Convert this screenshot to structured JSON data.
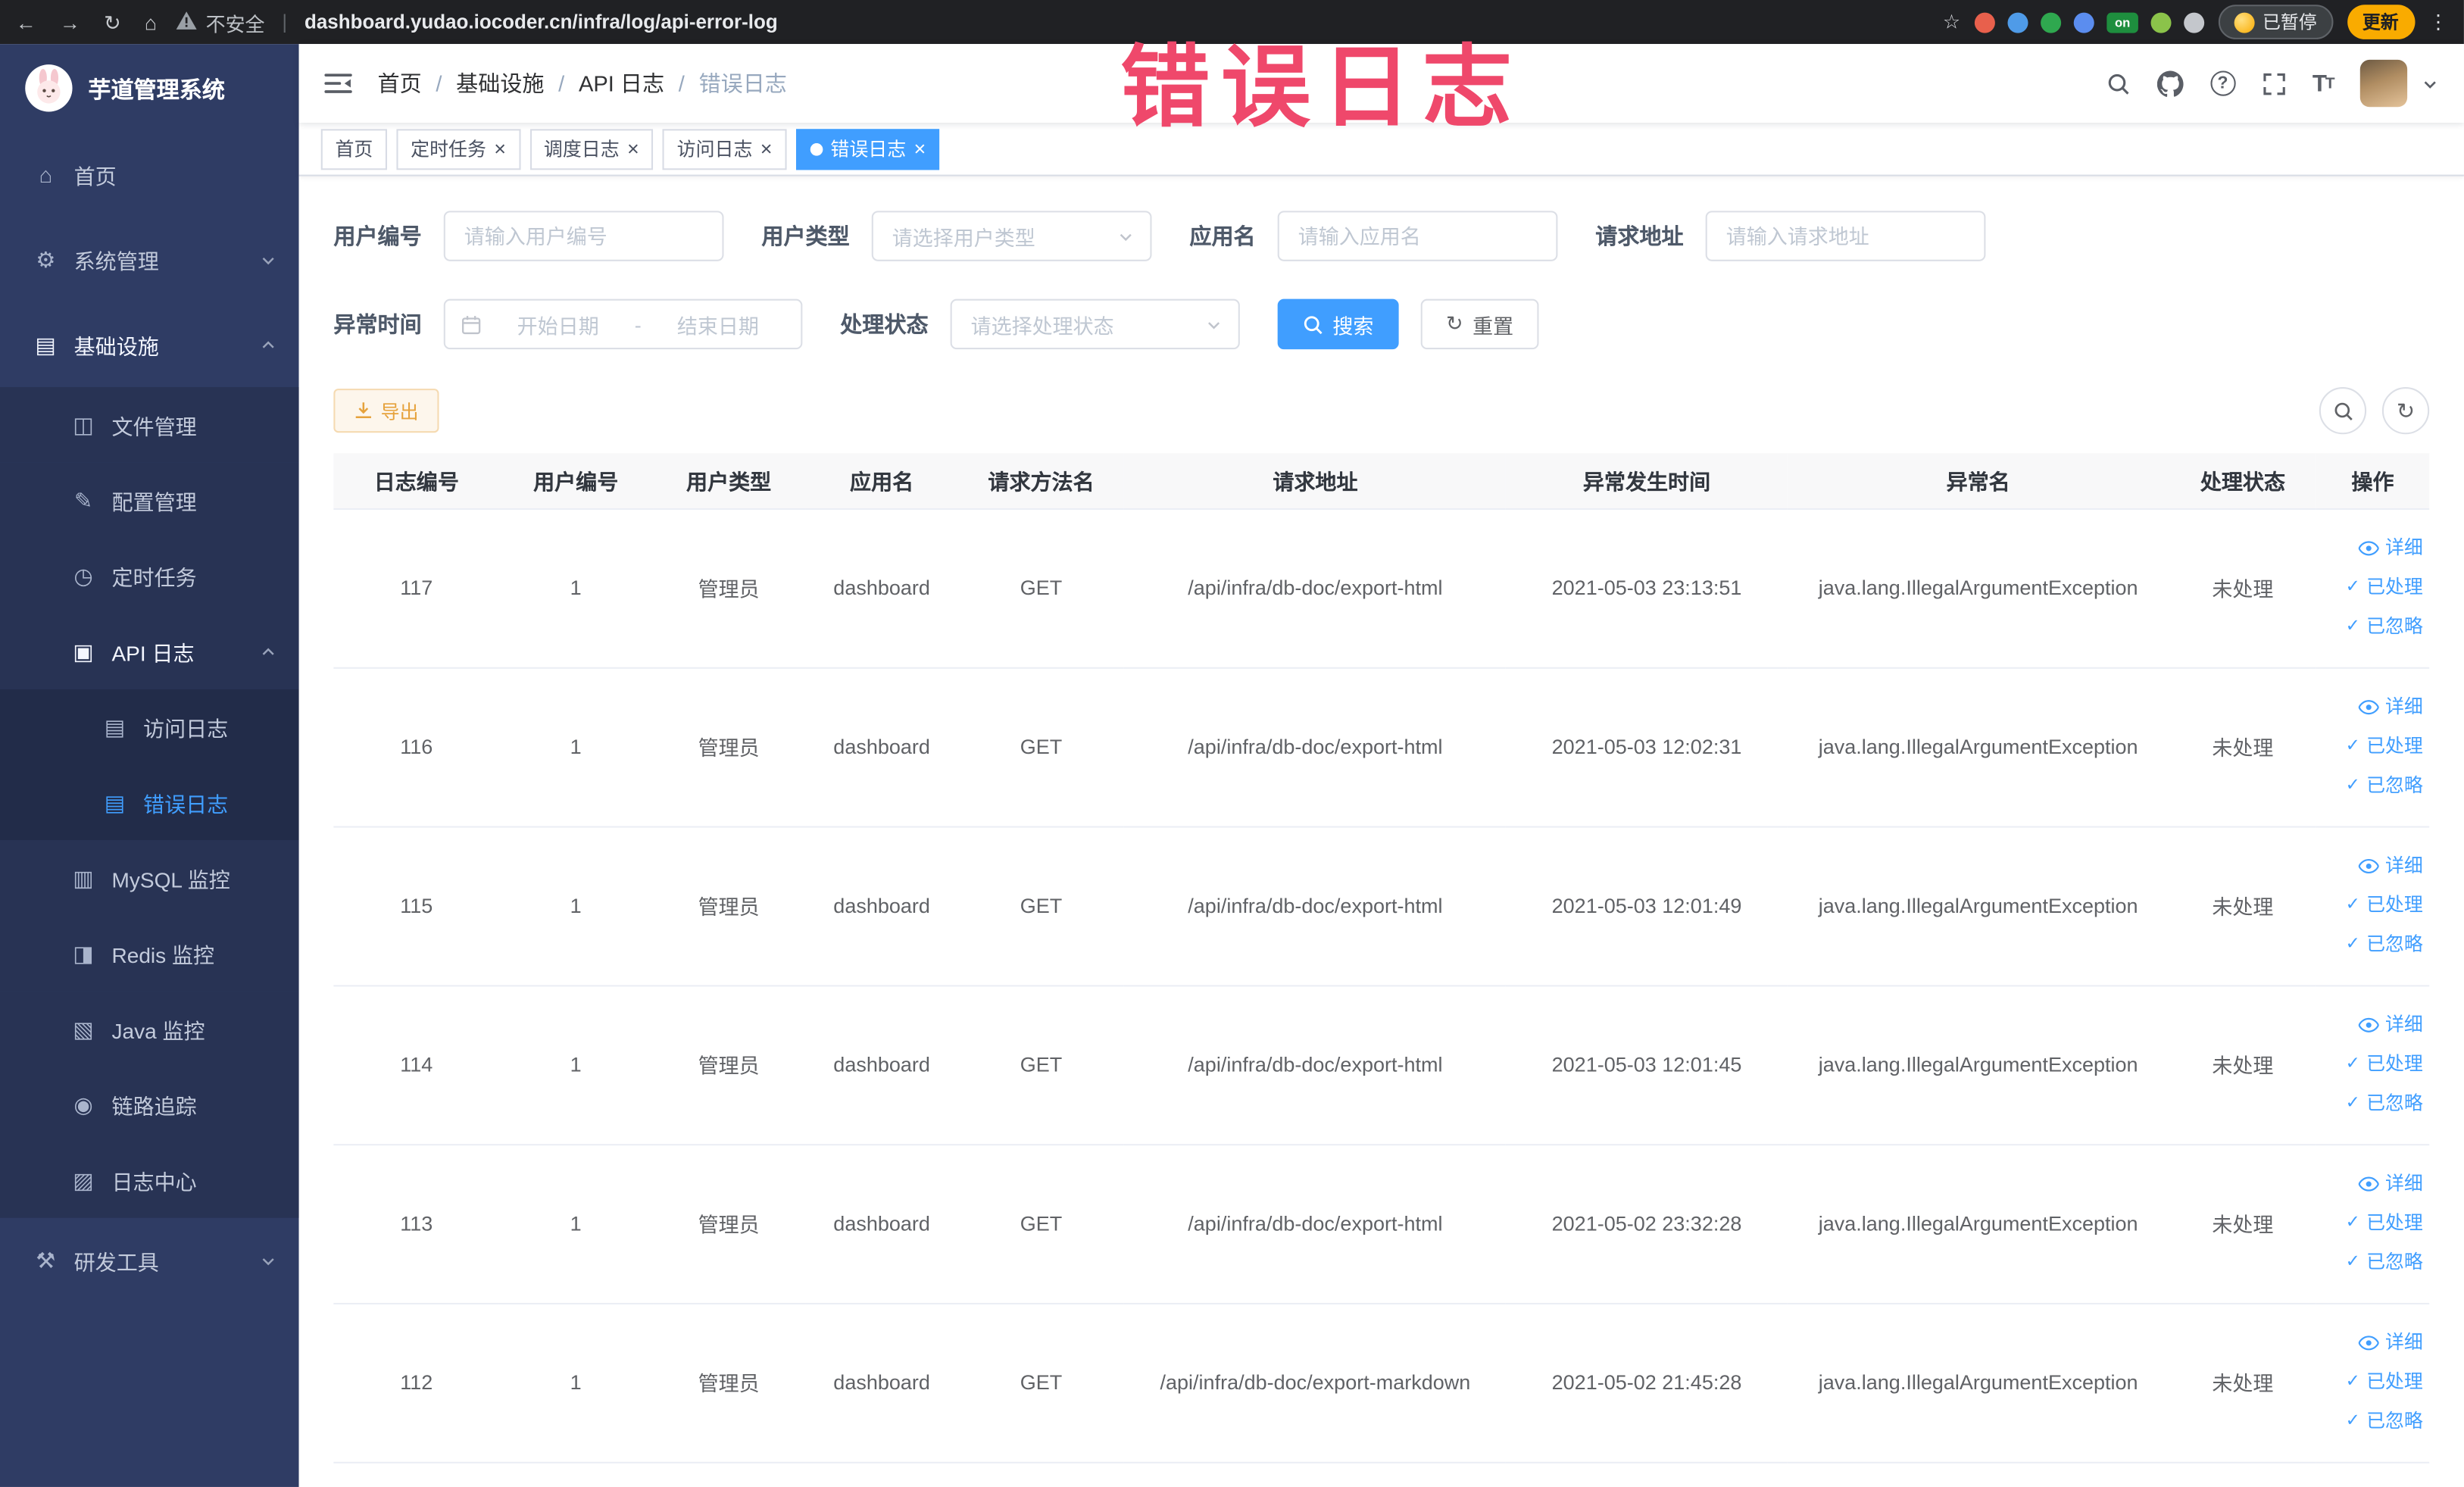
{
  "colors": {
    "accent": "#409eff",
    "warning": "#e6a23c",
    "annotation": "#ef486b",
    "sidebar_bg": "#2f3c64",
    "active_tab_bg": "#409eff"
  },
  "browser": {
    "security_label": "不安全",
    "url": "dashboard.yudao.iocoder.cn/infra/log/api-error-log",
    "paused_badge_label": "已暂停",
    "update_button_label": "更新",
    "extension_icons": [
      {
        "name": "extension-icon-1",
        "color": "#e8604c"
      },
      {
        "name": "extension-icon-2",
        "color": "#4f9be8"
      },
      {
        "name": "extension-icon-3",
        "color": "#2fa84f"
      },
      {
        "name": "extension-icon-4",
        "color": "#5b8def"
      },
      {
        "name": "extension-icon-on",
        "color": "#1e8e3e",
        "label": "on"
      },
      {
        "name": "extension-icon-6",
        "color": "#8bc34a"
      },
      {
        "name": "extension-icon-7",
        "color": "#c4c7cc"
      }
    ]
  },
  "sidebar": {
    "logo_title": "芋道管理系统",
    "items": [
      {
        "key": "home",
        "label": "首页",
        "icon": "home-icon",
        "glyph": "⌂",
        "level": 1
      },
      {
        "key": "system-management",
        "label": "系统管理",
        "icon": "gear-icon",
        "glyph": "⚙",
        "level": 1,
        "chevron": "down"
      },
      {
        "key": "infrastructure",
        "label": "基础设施",
        "icon": "infrastructure-icon",
        "glyph": "▤",
        "level": 1,
        "chevron": "up",
        "bright": true
      },
      {
        "key": "file-management",
        "label": "文件管理",
        "icon": "file-icon",
        "glyph": "◫",
        "level": 2
      },
      {
        "key": "config-management",
        "label": "配置管理",
        "icon": "config-icon",
        "glyph": "✎",
        "level": 2
      },
      {
        "key": "scheduled-tasks",
        "label": "定时任务",
        "icon": "timer-icon",
        "glyph": "◷",
        "level": 2
      },
      {
        "key": "api-log",
        "label": "API 日志",
        "icon": "api-log-icon",
        "glyph": "▣",
        "level": 2,
        "chevron": "up",
        "bright": true
      },
      {
        "key": "access-log",
        "label": "访问日志",
        "icon": "access-log-icon",
        "glyph": "▤",
        "level": 3
      },
      {
        "key": "error-log",
        "label": "错误日志",
        "icon": "error-log-icon",
        "glyph": "▤",
        "level": 3,
        "active": true
      },
      {
        "key": "mysql-monitor",
        "label": "MySQL 监控",
        "icon": "mysql-monitor-icon",
        "glyph": "▥",
        "level": 2
      },
      {
        "key": "redis-monitor",
        "label": "Redis 监控",
        "icon": "redis-monitor-icon",
        "glyph": "◨",
        "level": 2
      },
      {
        "key": "java-monitor",
        "label": "Java 监控",
        "icon": "java-monitor-icon",
        "glyph": "▧",
        "level": 2
      },
      {
        "key": "trace",
        "label": "链路追踪",
        "icon": "trace-icon",
        "glyph": "◉",
        "level": 2
      },
      {
        "key": "log-center",
        "label": "日志中心",
        "icon": "log-center-icon",
        "glyph": "▨",
        "level": 2
      },
      {
        "key": "dev-tools",
        "label": "研发工具",
        "icon": "dev-tools-icon",
        "glyph": "⚒",
        "level": 1,
        "chevron": "down"
      }
    ]
  },
  "navbar": {
    "breadcrumb": [
      {
        "label": "首页"
      },
      {
        "label": "基础设施"
      },
      {
        "label": "API 日志"
      },
      {
        "label": "错误日志",
        "current": true
      }
    ],
    "icons": [
      {
        "name": "search-icon"
      },
      {
        "name": "github-icon"
      },
      {
        "name": "help-icon"
      },
      {
        "name": "fullscreen-icon"
      },
      {
        "name": "font-size-icon"
      }
    ]
  },
  "tabs": [
    {
      "key": "home",
      "label": "首页",
      "closable": false,
      "active": false
    },
    {
      "key": "scheduled-tasks",
      "label": "定时任务",
      "closable": true,
      "active": false
    },
    {
      "key": "schedule-log",
      "label": "调度日志",
      "closable": true,
      "active": false
    },
    {
      "key": "access-log",
      "label": "访问日志",
      "closable": true,
      "active": false
    },
    {
      "key": "error-log",
      "label": "错误日志",
      "closable": true,
      "active": true
    }
  ],
  "filters": {
    "user_id_label": "用户编号",
    "user_id_placeholder": "请输入用户编号",
    "user_type_label": "用户类型",
    "user_type_placeholder": "请选择用户类型",
    "app_name_label": "应用名",
    "app_name_placeholder": "请输入应用名",
    "request_url_label": "请求地址",
    "request_url_placeholder": "请输入请求地址",
    "exception_time_label": "异常时间",
    "date_start_placeholder": "开始日期",
    "date_separator": "-",
    "date_end_placeholder": "结束日期",
    "process_status_label": "处理状态",
    "process_status_placeholder": "请选择处理状态",
    "search_button_label": "搜索",
    "reset_button_label": "重置"
  },
  "toolbar": {
    "export_button_label": "导出"
  },
  "table": {
    "columns": [
      "日志编号",
      "用户编号",
      "用户类型",
      "应用名",
      "请求方法名",
      "请求地址",
      "异常发生时间",
      "异常名",
      "处理状态",
      "操作"
    ],
    "row_actions": [
      {
        "label": "详细",
        "icon": "eye-icon"
      },
      {
        "label": "已处理",
        "icon": "check-icon"
      },
      {
        "label": "已忽略",
        "icon": "check-icon"
      }
    ],
    "rows": [
      {
        "log_id": "117",
        "user_id": "1",
        "user_type": "管理员",
        "app_name": "dashboard",
        "method": "GET",
        "request_url": "/api/infra/db-doc/export-html",
        "time": "2021-05-03 23:13:51",
        "exception": "java.lang.IllegalArgumentException",
        "status": "未处理"
      },
      {
        "log_id": "116",
        "user_id": "1",
        "user_type": "管理员",
        "app_name": "dashboard",
        "method": "GET",
        "request_url": "/api/infra/db-doc/export-html",
        "time": "2021-05-03 12:02:31",
        "exception": "java.lang.IllegalArgumentException",
        "status": "未处理"
      },
      {
        "log_id": "115",
        "user_id": "1",
        "user_type": "管理员",
        "app_name": "dashboard",
        "method": "GET",
        "request_url": "/api/infra/db-doc/export-html",
        "time": "2021-05-03 12:01:49",
        "exception": "java.lang.IllegalArgumentException",
        "status": "未处理"
      },
      {
        "log_id": "114",
        "user_id": "1",
        "user_type": "管理员",
        "app_name": "dashboard",
        "method": "GET",
        "request_url": "/api/infra/db-doc/export-html",
        "time": "2021-05-03 12:01:45",
        "exception": "java.lang.IllegalArgumentException",
        "status": "未处理"
      },
      {
        "log_id": "113",
        "user_id": "1",
        "user_type": "管理员",
        "app_name": "dashboard",
        "method": "GET",
        "request_url": "/api/infra/db-doc/export-html",
        "time": "2021-05-02 23:32:28",
        "exception": "java.lang.IllegalArgumentException",
        "status": "未处理"
      },
      {
        "log_id": "112",
        "user_id": "1",
        "user_type": "管理员",
        "app_name": "dashboard",
        "method": "GET",
        "request_url": "/api/infra/db-doc/export-markdown",
        "time": "2021-05-02 21:45:28",
        "exception": "java.lang.IllegalArgumentException",
        "status": "未处理"
      }
    ]
  },
  "annotation": {
    "text": "错误日志"
  }
}
